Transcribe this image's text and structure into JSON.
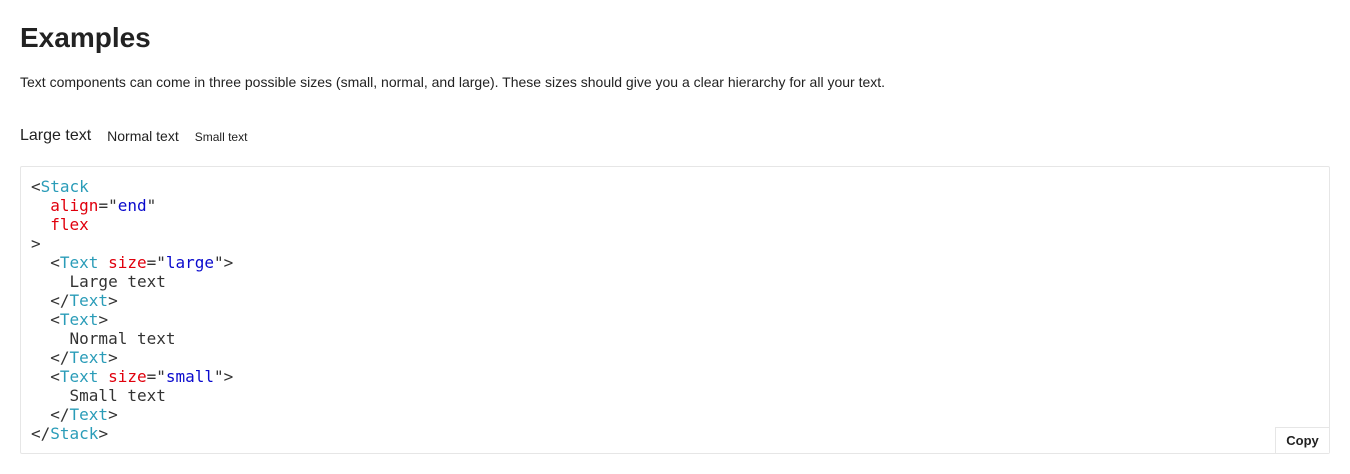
{
  "section": {
    "title": "Examples",
    "description": "Text components can come in three possible sizes (small, normal, and large). These sizes should give you a clear hierarchy for all your text."
  },
  "example": {
    "large_text": "Large text",
    "normal_text": "Normal text",
    "small_text": "Small text"
  },
  "code": {
    "lines": [
      [
        {
          "t": "<",
          "c": "punct"
        },
        {
          "t": "Stack",
          "c": "tag"
        }
      ],
      [
        {
          "t": "  ",
          "c": "punct"
        },
        {
          "t": "align",
          "c": "attr"
        },
        {
          "t": "=\"",
          "c": "punct"
        },
        {
          "t": "end",
          "c": "str"
        },
        {
          "t": "\"",
          "c": "punct"
        }
      ],
      [
        {
          "t": "  ",
          "c": "punct"
        },
        {
          "t": "flex",
          "c": "attr"
        }
      ],
      [
        {
          "t": ">",
          "c": "punct"
        }
      ],
      [
        {
          "t": "  <",
          "c": "punct"
        },
        {
          "t": "Text",
          "c": "tag"
        },
        {
          "t": " ",
          "c": "punct"
        },
        {
          "t": "size",
          "c": "attr"
        },
        {
          "t": "=\"",
          "c": "punct"
        },
        {
          "t": "large",
          "c": "str"
        },
        {
          "t": "\">",
          "c": "punct"
        }
      ],
      [
        {
          "t": "    Large text",
          "c": "punct"
        }
      ],
      [
        {
          "t": "  </",
          "c": "punct"
        },
        {
          "t": "Text",
          "c": "tag"
        },
        {
          "t": ">",
          "c": "punct"
        }
      ],
      [
        {
          "t": "  <",
          "c": "punct"
        },
        {
          "t": "Text",
          "c": "tag"
        },
        {
          "t": ">",
          "c": "punct"
        }
      ],
      [
        {
          "t": "    Normal text",
          "c": "punct"
        }
      ],
      [
        {
          "t": "  </",
          "c": "punct"
        },
        {
          "t": "Text",
          "c": "tag"
        },
        {
          "t": ">",
          "c": "punct"
        }
      ],
      [
        {
          "t": "  <",
          "c": "punct"
        },
        {
          "t": "Text",
          "c": "tag"
        },
        {
          "t": " ",
          "c": "punct"
        },
        {
          "t": "size",
          "c": "attr"
        },
        {
          "t": "=\"",
          "c": "punct"
        },
        {
          "t": "small",
          "c": "str"
        },
        {
          "t": "\">",
          "c": "punct"
        }
      ],
      [
        {
          "t": "    Small text",
          "c": "punct"
        }
      ],
      [
        {
          "t": "  </",
          "c": "punct"
        },
        {
          "t": "Text",
          "c": "tag"
        },
        {
          "t": ">",
          "c": "punct"
        }
      ],
      [
        {
          "t": "</",
          "c": "punct"
        },
        {
          "t": "Stack",
          "c": "tag"
        },
        {
          "t": ">",
          "c": "punct"
        }
      ]
    ],
    "copy_label": "Copy"
  },
  "colors": {
    "tag": "#2a9cb8",
    "attr": "#e0000d",
    "string": "#0a0acd",
    "text": "#222222",
    "border": "#e6e6e6"
  }
}
